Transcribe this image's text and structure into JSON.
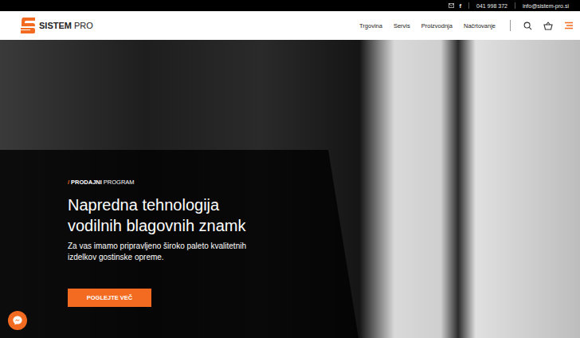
{
  "topbar": {
    "facebook": "f",
    "phone": "041 998 372",
    "email": "info@sistem-pro.si"
  },
  "logo": {
    "name": "SISTEM",
    "suffix": "PRO"
  },
  "nav": [
    {
      "label": "Trgovina",
      "selected": false
    },
    {
      "label": "Servis",
      "selected": false
    },
    {
      "label": "Proizvodnja",
      "selected": false
    },
    {
      "label": "Načrtovanje",
      "selected": false
    }
  ],
  "hero": {
    "eyebrow_mark": "/",
    "eyebrow_bold": "PRODAJNI",
    "eyebrow_rest": "PROGRAM",
    "title": "Napredna tehnologija vodilnih blagovnih znamk",
    "text": "Za vas imamo pripravljeno široko paleto kvalitetnih izdelkov gostinske opreme.",
    "button": "POGLEJTE VEČ"
  }
}
